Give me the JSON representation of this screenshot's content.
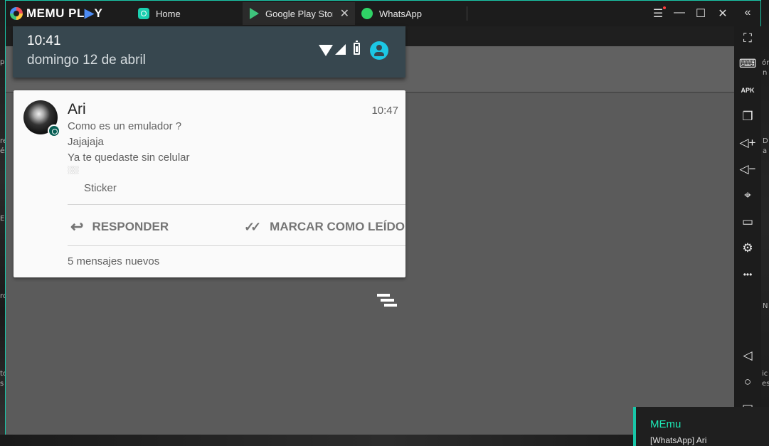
{
  "app": {
    "brand_left": "MEMU PL",
    "brand_accent": "▶",
    "brand_right": "Y",
    "accent_color": "#19c6a8"
  },
  "tabs": [
    {
      "label": "Home"
    },
    {
      "label": "Google Play Store",
      "close": "✕"
    },
    {
      "label": "WhatsApp"
    }
  ],
  "window_controls": {
    "menu": "☰",
    "minimize": "—",
    "maximize": "☐",
    "close": "✕",
    "collapse": "«"
  },
  "shade": {
    "time": "10:41",
    "date": "domingo 12 de abril"
  },
  "notification": {
    "sender": "Ari",
    "time": "10:47",
    "lines": [
      "Como es un emulador ?",
      "Jajajaja",
      "Ya te quedaste sin celular",
      "░░"
    ],
    "sticker": "Sticker",
    "actions": [
      {
        "icon": "↩",
        "label": "RESPONDER"
      },
      {
        "icon": "✓✓",
        "label": "MARCAR COMO LEÍDO"
      }
    ],
    "footer": "5 mensajes nuevos"
  },
  "toolbar": {
    "fullscreen": "⛶",
    "keyboard": "⌨",
    "apk": "APK",
    "multi": "❐",
    "vol_up": "◁+",
    "vol_down": "◁−",
    "location": "⌖",
    "folder": "▭",
    "settings": "⚙",
    "more": "•••",
    "back": "◁",
    "home": "○",
    "recent": "▭"
  },
  "toast": {
    "title": "MEmu",
    "body": "[WhatsApp] Ari"
  },
  "desktop_fragments": [
    "pl",
    "ón",
    "n",
    "re",
    "és",
    "D",
    "a",
    "Ec",
    "ro",
    "N",
    "to",
    "s",
    "ic",
    "es"
  ]
}
